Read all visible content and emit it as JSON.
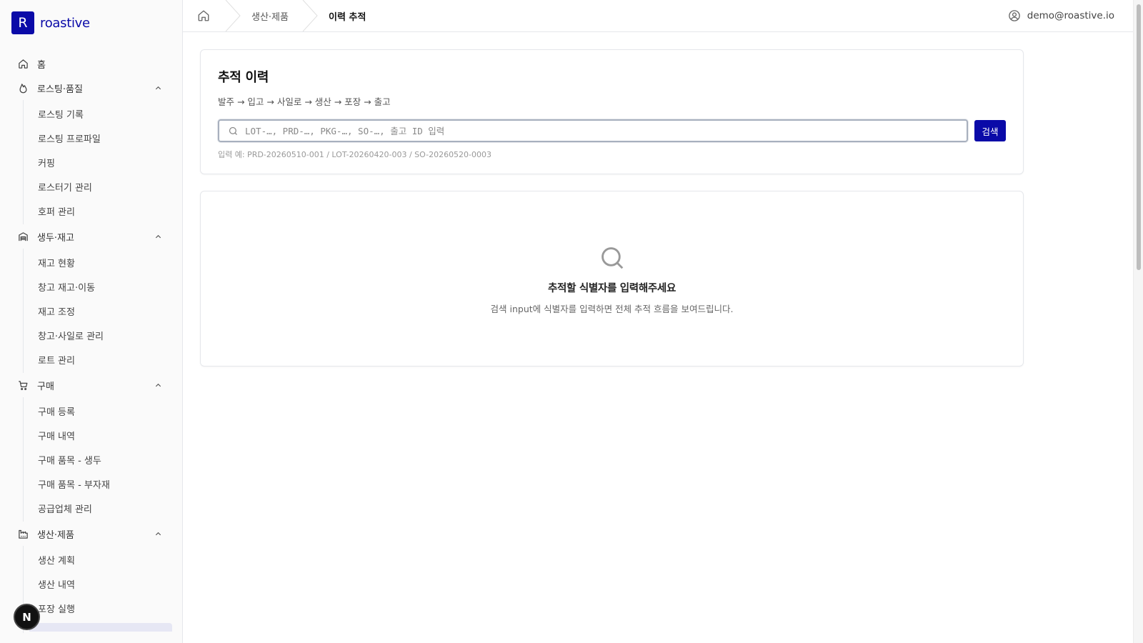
{
  "brand": {
    "logo_letter": "R",
    "name": "roastive",
    "color": "#0a0aa8"
  },
  "sidebar": {
    "home": "홈",
    "groups": [
      {
        "label": "로스팅·품질",
        "icon": "flame-icon",
        "items": [
          "로스팅 기록",
          "로스팅 프로파일",
          "커핑",
          "로스터기 관리",
          "호퍼 관리"
        ]
      },
      {
        "label": "생두·재고",
        "icon": "warehouse-icon",
        "items": [
          "재고 현황",
          "창고 재고·이동",
          "재고 조정",
          "창고·사일로 관리",
          "로트 관리"
        ]
      },
      {
        "label": "구매",
        "icon": "cart-icon",
        "items": [
          "구매 등록",
          "구매 내역",
          "구매 품목 - 생두",
          "구매 품목 - 부자재",
          "공급업체 관리"
        ]
      },
      {
        "label": "생산·제품",
        "icon": "factory-icon",
        "items": [
          "생산 계획",
          "생산 내역",
          "포장 실행"
        ]
      }
    ]
  },
  "floating_badge": "N",
  "header": {
    "breadcrumbs": [
      "생산·제품",
      "이력 추적"
    ],
    "user_email": "demo@roastive.io"
  },
  "trace": {
    "title": "추적 이력",
    "flow": "발주 → 입고 → 사일로 → 생산 → 포장 → 출고",
    "search_placeholder": "LOT-…, PRD-…, PKG-…, SO-…, 출고 ID 입력",
    "search_value": "",
    "search_button": "검색",
    "hint": "입력 예: PRD-20260510-001 / LOT-20260420-003 / SO-20260520-0003"
  },
  "empty_state": {
    "title": "추적할 식별자를 입력해주세요",
    "description": "검색 input에 식별자를 입력하면 전체 추적 흐름을 보여드립니다."
  }
}
